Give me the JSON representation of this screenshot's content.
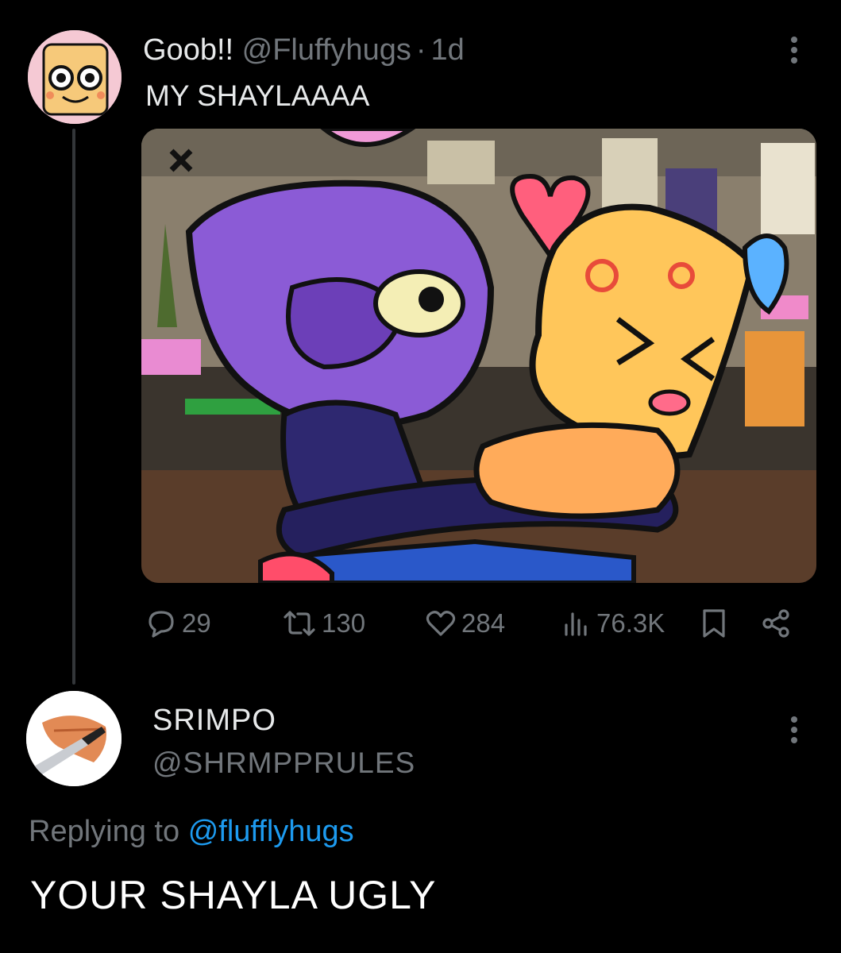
{
  "post": {
    "display_name": "Goob!!",
    "handle": "@Fluffyhugs",
    "separator": "·",
    "time": "1d",
    "text": "MY SHAYLAAAA",
    "stats": {
      "replies": "29",
      "reposts": "130",
      "likes": "284",
      "views": "76.3K"
    }
  },
  "reply": {
    "display_name": "SRIMPO",
    "handle": "@SHRMPPRULES",
    "replying_prefix": "Replying to",
    "replying_handle": "@flufflyhugs",
    "text": "YOUR SHAYLA UGLY"
  },
  "icons": {
    "more": "more-vertical-icon",
    "reply": "comment-bubble-icon",
    "repost": "repost-arrows-icon",
    "like": "heart-icon",
    "views": "bar-chart-icon",
    "bookmark": "bookmark-icon",
    "share": "share-icon"
  },
  "colors": {
    "background": "#000000",
    "text": "#e7e9ea",
    "muted": "#71767b",
    "link": "#1d9bf0",
    "thread_line": "#333639"
  }
}
